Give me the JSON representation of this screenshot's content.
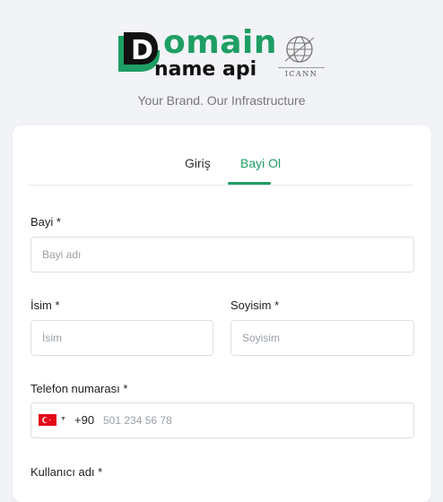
{
  "brand": {
    "logo_word1": "omain",
    "logo_letter": "D",
    "logo_word2": "name api",
    "icann_label": "ICANN",
    "tagline": "Your Brand. Our Infrastructure",
    "accent_color": "#1e9e64"
  },
  "tabs": {
    "login": "Giriş",
    "reseller": "Bayi Ol",
    "active": "reseller"
  },
  "form": {
    "reseller_label": "Bayi *",
    "reseller_placeholder": "Bayi adı",
    "name_label": "İsim *",
    "name_placeholder": "İsim",
    "surname_label": "Soyisim *",
    "surname_placeholder": "Soyisim",
    "phone_label": "Telefon numarası *",
    "phone_country": "turkey-flag-icon",
    "phone_dial_code": "+90",
    "phone_placeholder": "501 234 56 78",
    "username_label": "Kullanıcı adı *"
  }
}
